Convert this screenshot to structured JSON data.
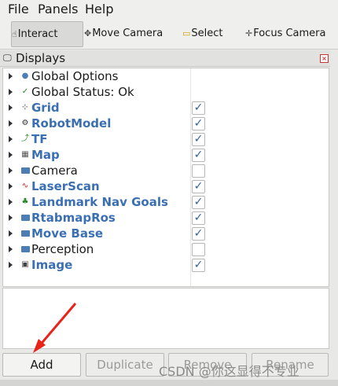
{
  "menu": {
    "file": "File",
    "panels": "Panels",
    "help": "Help"
  },
  "toolbar": {
    "interact": "Interact",
    "move_camera": "Move Camera",
    "select": "Select",
    "focus_camera": "Focus Camera"
  },
  "panel": {
    "title": "Displays"
  },
  "displays": [
    {
      "label": "Global Options",
      "icon": "globe-icon",
      "checked": null
    },
    {
      "label": "Global Status: Ok",
      "icon": "check-icon",
      "checked": null
    },
    {
      "label": "Grid",
      "icon": "grid-icon",
      "checked": true,
      "plugin": true
    },
    {
      "label": "RobotModel",
      "icon": "robot-icon",
      "checked": true,
      "plugin": true
    },
    {
      "label": "TF",
      "icon": "tf-icon",
      "checked": true,
      "plugin": true
    },
    {
      "label": "Map",
      "icon": "map-icon",
      "checked": true,
      "plugin": true
    },
    {
      "label": "Camera",
      "icon": "folder-icon",
      "checked": false
    },
    {
      "label": "LaserScan",
      "icon": "laserscan-icon",
      "checked": true,
      "plugin": true
    },
    {
      "label": "Landmark Nav Goals",
      "icon": "landmark-icon",
      "checked": true,
      "plugin": true
    },
    {
      "label": "RtabmapRos",
      "icon": "folder-icon",
      "checked": true,
      "plugin": true
    },
    {
      "label": "Move Base",
      "icon": "folder-icon",
      "checked": true,
      "plugin": true
    },
    {
      "label": "Perception",
      "icon": "folder-icon",
      "checked": false
    },
    {
      "label": "Image",
      "icon": "image-icon",
      "checked": true,
      "plugin": true
    }
  ],
  "buttons": {
    "add": "Add",
    "duplicate": "Duplicate",
    "remove": "Remove",
    "rename": "Rename"
  },
  "watermark": "CSDN @你这显得不专业",
  "colors": {
    "plugin_text": "#3a6fb3",
    "annotation_arrow": "#e8231a"
  }
}
